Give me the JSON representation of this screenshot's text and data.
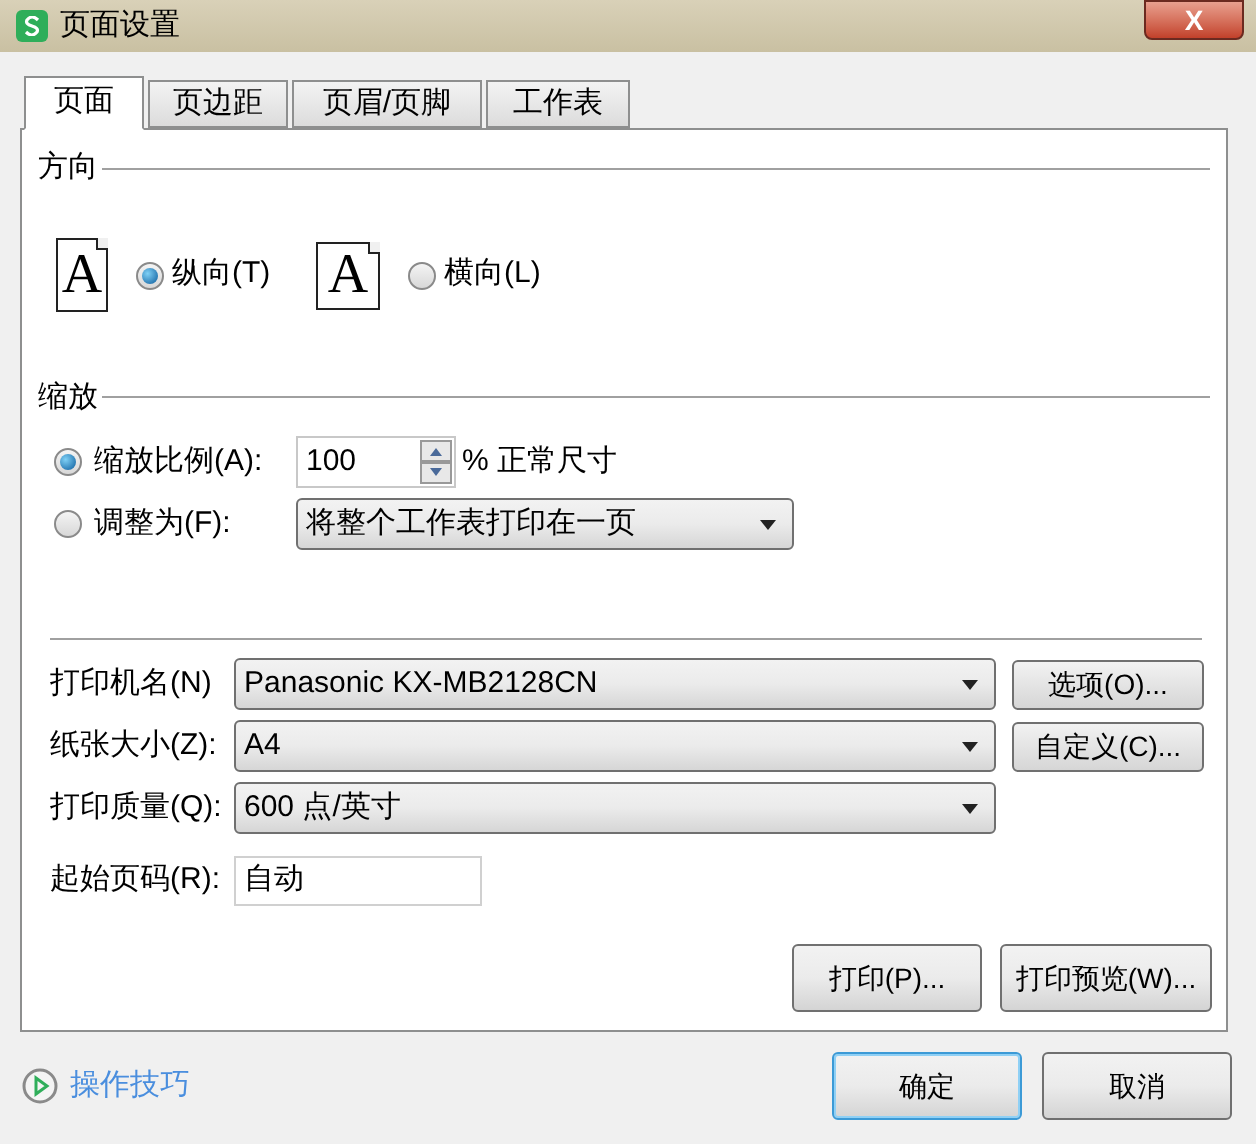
{
  "window": {
    "title": "页面设置",
    "close_glyph": "X"
  },
  "tabs": [
    {
      "label": "页面",
      "selected": true
    },
    {
      "label": "页边距",
      "selected": false
    },
    {
      "label": "页眉/页脚",
      "selected": false
    },
    {
      "label": "工作表",
      "selected": false
    }
  ],
  "orientation": {
    "heading": "方向",
    "options": [
      {
        "icon_glyph": "A",
        "label": "纵向(T)",
        "selected": true,
        "kind": "portrait"
      },
      {
        "icon_glyph": "A",
        "label": "横向(L)",
        "selected": false,
        "kind": "landscape"
      }
    ]
  },
  "scaling": {
    "heading": "缩放",
    "options": [
      {
        "kind": "spin",
        "label": "缩放比例(A):",
        "selected": true,
        "value": "100",
        "suffix": "% 正常尺寸"
      },
      {
        "kind": "dropdown",
        "label": "调整为(F):",
        "selected": false,
        "value": "将整个工作表打印在一页"
      }
    ]
  },
  "printer_rows": [
    {
      "kind": "dropdown",
      "label": "打印机名(N)",
      "value": "Panasonic KX-MB2128CN",
      "button": "选项(O)..."
    },
    {
      "kind": "dropdown",
      "label": "纸张大小(Z):",
      "value": "A4",
      "button": "自定义(C)..."
    },
    {
      "kind": "dropdown",
      "label": "打印质量(Q):",
      "value": "600 点/英寸"
    },
    {
      "kind": "text",
      "label": "起始页码(R):",
      "value": "自动"
    }
  ],
  "panel_buttons": [
    "打印(P)...",
    "打印预览(W)..."
  ],
  "tips_link": "操作技巧",
  "dialog_buttons": [
    {
      "label": "确定",
      "focused": true
    },
    {
      "label": "取消",
      "focused": false
    }
  ]
}
